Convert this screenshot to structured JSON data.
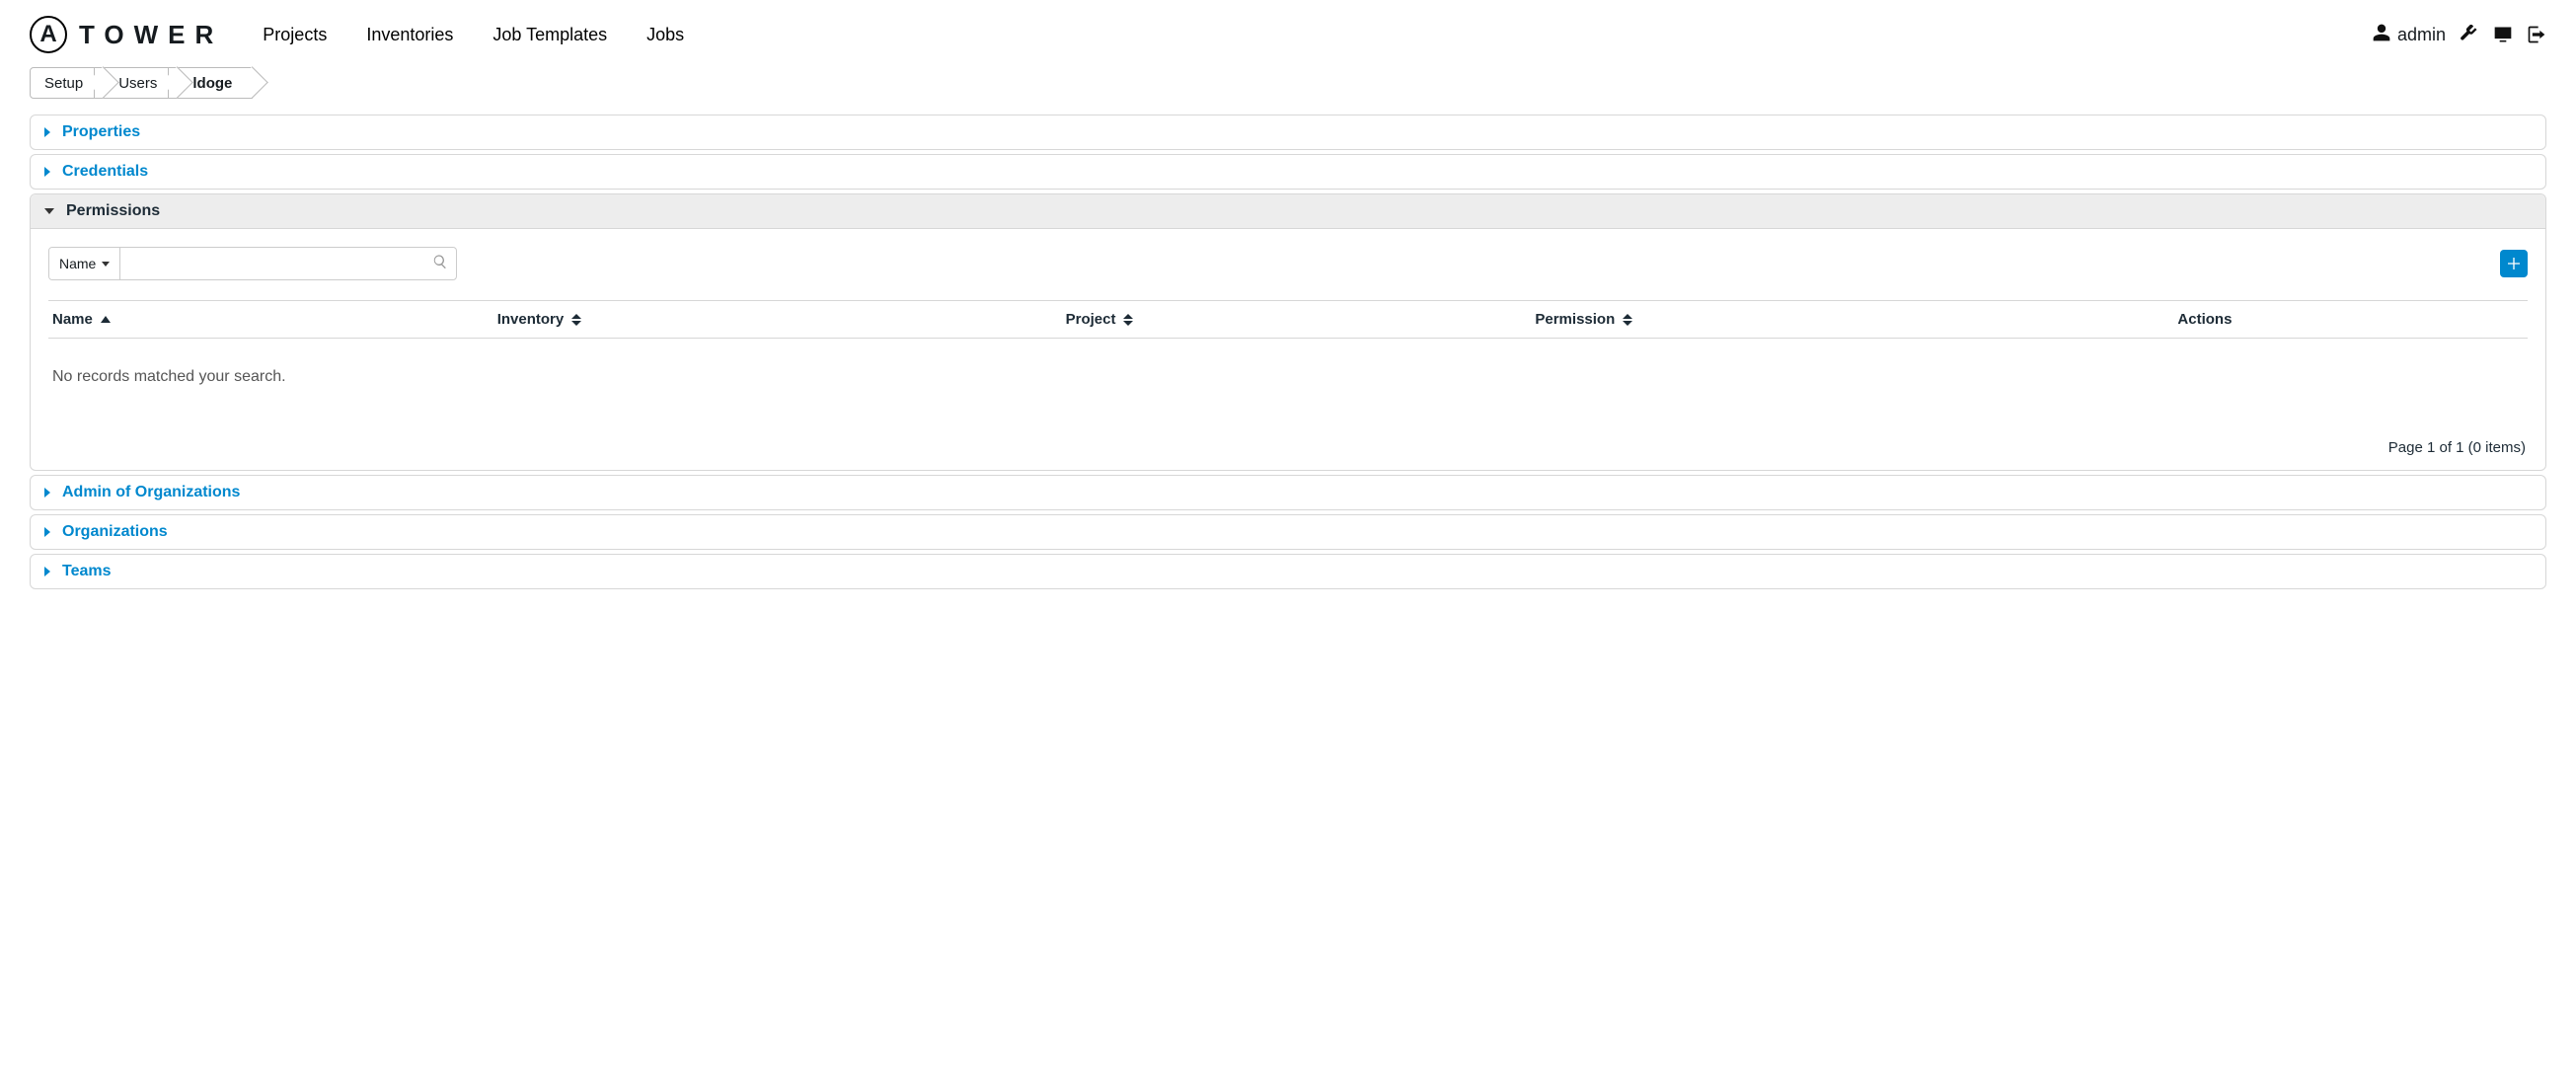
{
  "brand": {
    "mark": "A",
    "name": "TOWER"
  },
  "nav": {
    "projects": "Projects",
    "inventories": "Inventories",
    "job_templates": "Job Templates",
    "jobs": "Jobs"
  },
  "header": {
    "username": "admin"
  },
  "breadcrumb": {
    "setup": "Setup",
    "users": "Users",
    "current": "ldoge"
  },
  "panels": {
    "properties": "Properties",
    "credentials": "Credentials",
    "permissions": "Permissions",
    "admin_orgs": "Admin of Organizations",
    "organizations": "Organizations",
    "teams": "Teams"
  },
  "permissions": {
    "search_type": "Name",
    "columns": {
      "name": "Name",
      "inventory": "Inventory",
      "project": "Project",
      "permission": "Permission",
      "actions": "Actions"
    },
    "empty": "No records matched your search.",
    "pager": "Page 1 of 1 (0 items)"
  }
}
